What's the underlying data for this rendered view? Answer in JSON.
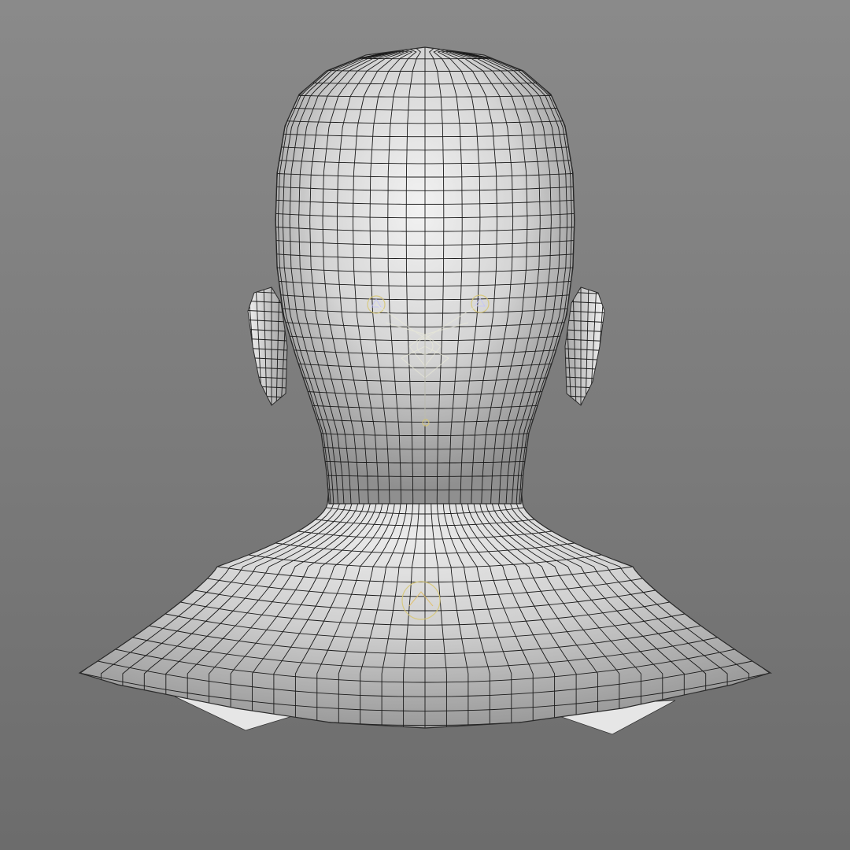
{
  "viewport": {
    "view": "back",
    "subject": "head-and-neck-mesh",
    "shading": "smooth-with-wireframe",
    "colors": {
      "background_top": "#8a8a8a",
      "background_bottom": "#6c6c6c",
      "mesh_light": "#eeeeee",
      "mesh_mid": "#c8c8c8",
      "mesh_dark": "#8e8e8e",
      "wire": "#1a1a1a",
      "joint_marker": "#d8c878"
    },
    "rig_markers": [
      "joint-left-eye",
      "joint-right-eye",
      "joint-head",
      "joint-jaw",
      "joint-neck",
      "joint-chest"
    ]
  }
}
